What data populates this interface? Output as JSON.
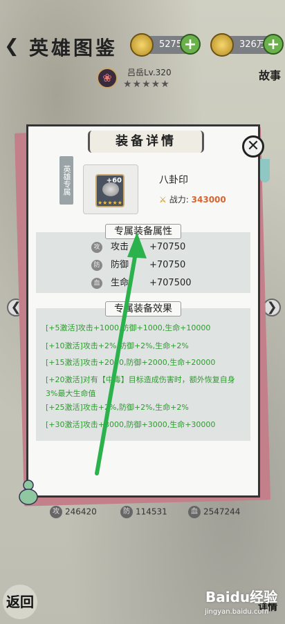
{
  "header": {
    "title": "英雄图鉴",
    "gold": "5275",
    "coins": "326万",
    "story_label": "故事"
  },
  "hero": {
    "name": "吕岳Lv.320",
    "stars": "★★★★★"
  },
  "modal": {
    "title": "装备详情",
    "tag": "英雄专属",
    "item_name": "八卦印",
    "item_level": "+60",
    "power_label": "战力:",
    "power_value": "343000",
    "attr_section_title": "专属装备属性",
    "attrs": [
      {
        "icon": "攻",
        "label": "攻击",
        "value": "+70750"
      },
      {
        "icon": "防",
        "label": "防御",
        "value": "+70750"
      },
      {
        "icon": "血",
        "label": "生命",
        "value": "+707500"
      }
    ],
    "effect_section_title": "专属装备效果",
    "effects": [
      "[+5激活]攻击+1000,防御+1000,生命+10000",
      "[+10激活]攻击+2%,防御+2%,生命+2%",
      "[+15激活]攻击+2000,防御+2000,生命+20000",
      "[+20激活]对有【中毒】目标造成伤害时，额外恢复自身3%最大生命值",
      "[+25激活]攻击+2%,防御+2%,生命+2%",
      "[+30激活]攻击+3000,防御+3000,生命+30000"
    ]
  },
  "bottom_stats": [
    {
      "icon": "攻",
      "value": "246420"
    },
    {
      "icon": "防",
      "value": "114531"
    },
    {
      "icon": "血",
      "value": "2547244"
    }
  ],
  "nav": {
    "back_label": "返回",
    "detail_label": "详情"
  },
  "watermark": {
    "brand": "Baidu经验",
    "url": "jingyan.baidu.com"
  },
  "colors": {
    "power_value": "#d7632e",
    "effect_text": "#2e9a2e",
    "annotation_arrow": "#2bb24c"
  }
}
